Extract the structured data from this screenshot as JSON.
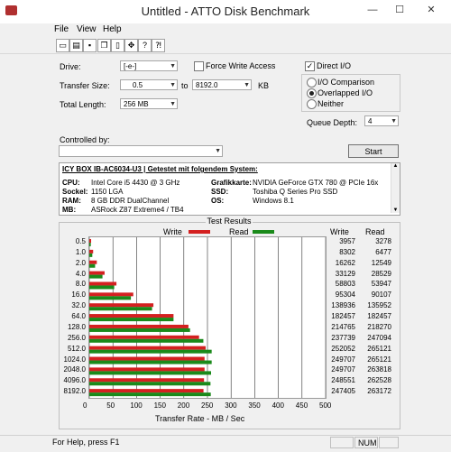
{
  "window": {
    "title": "Untitled - ATTO Disk Benchmark",
    "minimize": "—",
    "maximize": "☐",
    "close": "✕"
  },
  "menu": {
    "file": "File",
    "view": "View",
    "help": "Help"
  },
  "controls": {
    "drive_label": "Drive:",
    "drive_value": "[-e-]",
    "force_write_access": "Force Write Access",
    "direct_io": "Direct I/O",
    "direct_io_checked": true,
    "transfer_size_label": "Transfer Size:",
    "transfer_from": "0.5",
    "transfer_to_word": "to",
    "transfer_to": "8192.0",
    "transfer_unit": "KB",
    "total_length_label": "Total Length:",
    "total_length_value": "256 MB",
    "io_comparison": "I/O Comparison",
    "overlapped_io": "Overlapped I/O",
    "neither": "Neither",
    "queue_depth_label": "Queue Depth:",
    "queue_depth_value": "4",
    "controlled_by_label": "Controlled by:",
    "controlled_by_value": "",
    "start_button": "Start"
  },
  "description": {
    "headline": "ICY BOX IB-AC6034-U3  |  Getestet mit folgendem System:",
    "rows": [
      {
        "k1": "CPU:",
        "v1": "Intel Core i5 4430 @ 3 GHz",
        "k2": "Grafikkarte:",
        "v2": "NVIDIA GeForce GTX 780 @ PCIe 16x"
      },
      {
        "k1": "Sockel:",
        "v1": "1150 LGA",
        "k2": "SSD:",
        "v2": "Toshiba Q Series Pro SSD"
      },
      {
        "k1": "RAM:",
        "v1": "8 GB DDR DualChannel",
        "k2": "OS:",
        "v2": "Windows 8.1"
      },
      {
        "k1": "MB:",
        "v1": "ASRock Z87 Extreme4 / TB4",
        "k2": "",
        "v2": ""
      }
    ]
  },
  "results": {
    "title": "Test Results",
    "legend_write": "Write",
    "legend_read": "Read",
    "col_write": "Write",
    "col_read": "Read",
    "write_values": [
      "3957",
      "8302",
      "16262",
      "33129",
      "58803",
      "95304",
      "138936",
      "182457",
      "214765",
      "237739",
      "252052",
      "249707",
      "249707",
      "248551",
      "247405"
    ],
    "read_values": [
      "3278",
      "6477",
      "12549",
      "28529",
      "53947",
      "90107",
      "135952",
      "182457",
      "218270",
      "247094",
      "265121",
      "265121",
      "263818",
      "262528",
      "263172"
    ]
  },
  "chart_data": {
    "type": "bar",
    "orientation": "horizontal",
    "categories": [
      "0.5",
      "1.0",
      "2.0",
      "4.0",
      "8.0",
      "16.0",
      "32.0",
      "64.0",
      "128.0",
      "256.0",
      "512.0",
      "1024.0",
      "2048.0",
      "4096.0",
      "8192.0"
    ],
    "series": [
      {
        "name": "Write",
        "color": "#d42020",
        "values": [
          3957,
          8302,
          16262,
          33129,
          58803,
          95304,
          138936,
          182457,
          214765,
          237739,
          252052,
          249707,
          249707,
          248551,
          247405
        ]
      },
      {
        "name": "Read",
        "color": "#1a8a1a",
        "values": [
          3278,
          6477,
          12549,
          28529,
          53947,
          90107,
          135952,
          182457,
          218270,
          247094,
          265121,
          265121,
          263818,
          262528,
          263172
        ]
      }
    ],
    "xlabel": "Transfer Rate - MB / Sec",
    "x_ticks": [
      "0",
      "50",
      "100",
      "150",
      "200",
      "250",
      "300",
      "350",
      "400",
      "450",
      "500"
    ],
    "xlim": [
      0,
      500
    ],
    "value_scale": "KB/s values shown in columns; bars in MB/s",
    "grid": true,
    "legend_placement": "top"
  },
  "status": {
    "help": "For Help, press F1",
    "num": "NUM"
  },
  "colors": {
    "write": "#d42020",
    "read": "#1a8a1a"
  }
}
